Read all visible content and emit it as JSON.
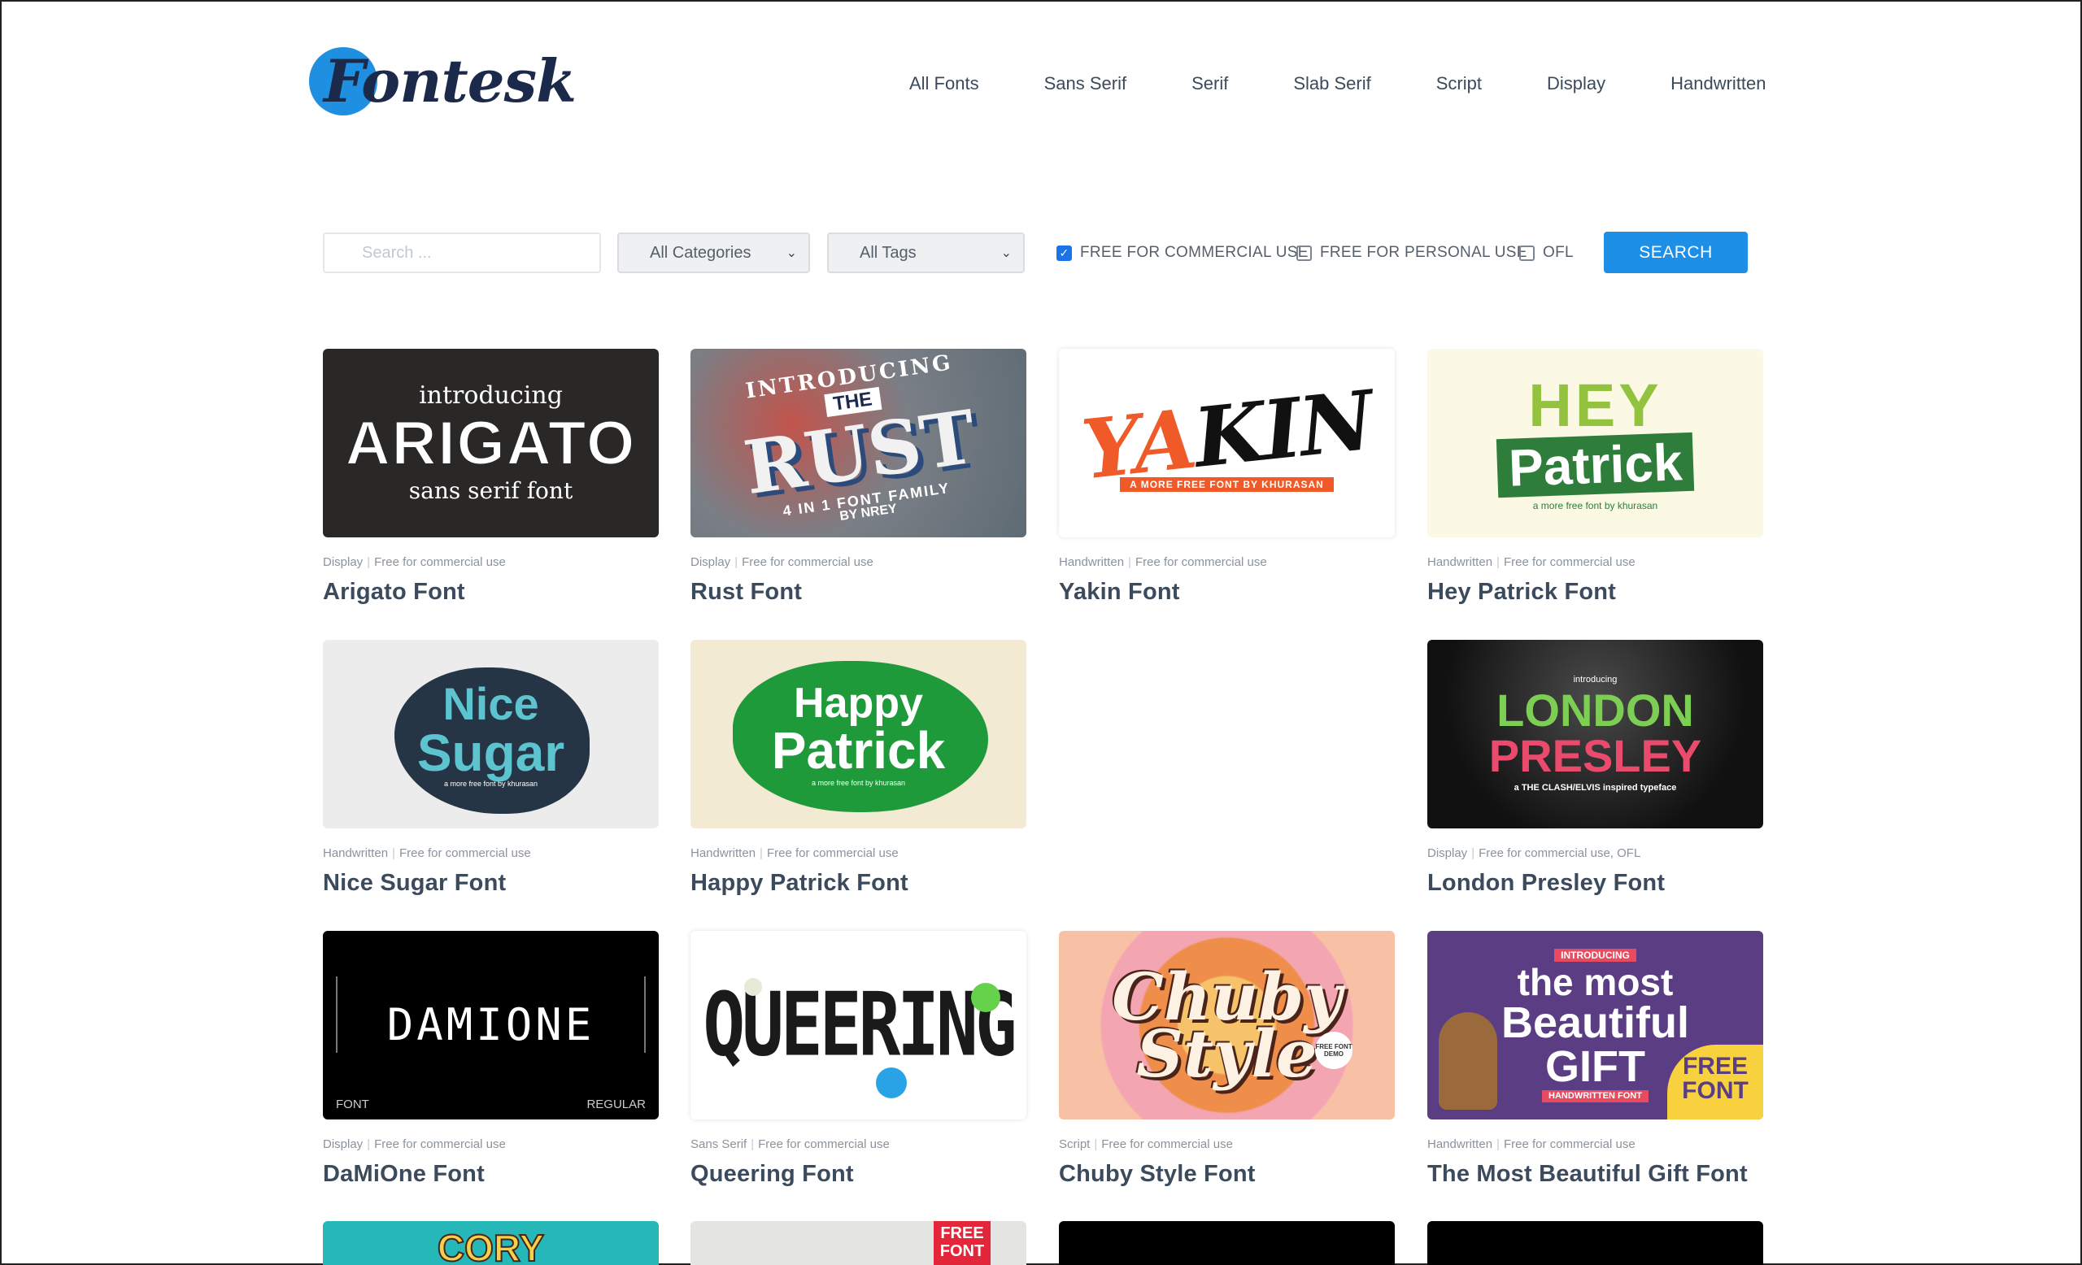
{
  "brand": {
    "name": "Fontesk"
  },
  "nav": [
    "All Fonts",
    "Sans Serif",
    "Serif",
    "Slab Serif",
    "Script",
    "Display",
    "Handwritten"
  ],
  "filters": {
    "search_placeholder": "Search ...",
    "category": "All Categories",
    "tag": "All Tags",
    "checkboxes": [
      {
        "label": "FREE FOR COMMERCIAL USE",
        "checked": true
      },
      {
        "label": "FREE FOR PERSONAL USE",
        "checked": false
      },
      {
        "label": "OFL",
        "checked": false
      }
    ],
    "search_button": "SEARCH"
  },
  "fonts": [
    {
      "category": "Display",
      "license": "Free for commercial use",
      "title": "Arigato Font",
      "art": [
        "introducing",
        "ARIGATO",
        "sans serif font"
      ],
      "bg": "#2a2727",
      "fg": "#ffffff"
    },
    {
      "category": "Display",
      "license": "Free for commercial use",
      "title": "Rust Font",
      "art": [
        "INTRODUCING",
        "THE",
        "RUST",
        "4 IN 1 FONT FAMILY",
        "BY NREY"
      ],
      "bg": "#6b7b86",
      "fg": "#ffffff"
    },
    {
      "category": "Handwritten",
      "license": "Free for commercial use",
      "title": "Yakin Font",
      "art": [
        "YAKIN",
        "A MORE FREE FONT BY KHURASAN"
      ],
      "bg": "#ffffff",
      "fg": "#111111"
    },
    {
      "category": "Handwritten",
      "license": "Free for commercial use",
      "title": "Hey Patrick Font",
      "art": [
        "HEY",
        "Patrick",
        "a more free font by khurasan"
      ],
      "bg": "#fbf8e4",
      "fg": "#2e7d3a"
    },
    {
      "category": "Handwritten",
      "license": "Free for commercial use",
      "title": "Nice Sugar Font",
      "art": [
        "Nice",
        "Sugar",
        "a more free font by khurasan"
      ],
      "bg": "#ececec",
      "fg": "#5cc3cf"
    },
    {
      "category": "Handwritten",
      "license": "Free for commercial use",
      "title": "Happy Patrick Font",
      "art": [
        "Happy",
        "Patrick",
        "a more free font by khurasan"
      ],
      "bg": "#f3ead3",
      "fg": "#ffffff"
    },
    {
      "category": "Display",
      "license": "Free for commercial use, OFL",
      "title": "London Presley Font",
      "art": [
        "introducing",
        "LONDON",
        "PRESLEY",
        "a THE CLASH/ELVIS inspired typeface"
      ],
      "bg": "#1a1a1a",
      "fg": "#7ccf53"
    },
    {
      "category": "Display",
      "license": "Free for commercial use",
      "title": "DaMiOne Font",
      "art": [
        "DAMIONE",
        "FONT",
        "REGULAR"
      ],
      "bg": "#000000",
      "fg": "#ffffff"
    },
    {
      "category": "Sans Serif",
      "license": "Free for commercial use",
      "title": "Queering Font",
      "art": [
        "QUEERING"
      ],
      "bg": "#ffffff",
      "fg": "#1a1a1a"
    },
    {
      "category": "Script",
      "license": "Free for commercial use",
      "title": "Chuby Style Font",
      "art": [
        "Chuby",
        "Style",
        "FREE FONT DEMO"
      ],
      "bg": "#f7b88c",
      "fg": "#fdf1e4"
    },
    {
      "category": "Handwritten",
      "license": "Free for commercial use",
      "title": "The Most Beautiful Gift Font",
      "art": [
        "INTRODUCING",
        "the most",
        "Beautiful",
        "GIFT",
        "FREE FONT",
        "HANDWRITTEN FONT"
      ],
      "bg": "#5a3d83",
      "fg": "#ffffff"
    }
  ],
  "partial_row": [
    {
      "art": "CORY",
      "bg": "#26b7b9"
    },
    {
      "art": "FREE FONT",
      "bg": "#e4e4e2"
    },
    {
      "art": "",
      "bg": "#000000"
    },
    {
      "art": "",
      "bg": "#000000"
    }
  ]
}
